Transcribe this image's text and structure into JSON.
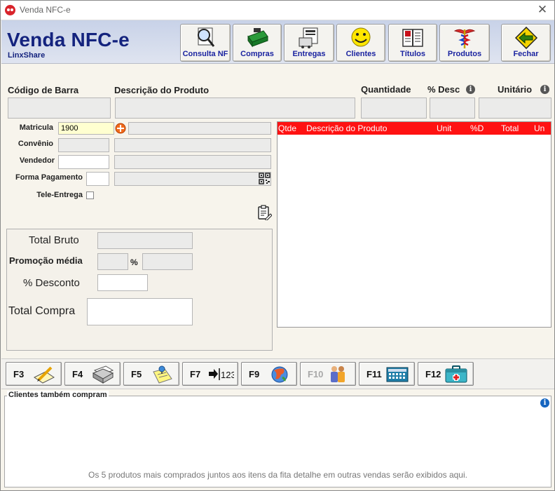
{
  "window": {
    "title": "Venda NFC-e",
    "close_glyph": "✕"
  },
  "header": {
    "brand": "Venda NFC-e",
    "brand_sub": "LinxShare",
    "buttons": [
      {
        "label": "Consulta NF",
        "icon": "magnifier-icon"
      },
      {
        "label": "Compras",
        "icon": "cash-register-icon"
      },
      {
        "label": "Entregas",
        "icon": "delivery-icon"
      },
      {
        "label": "Clientes",
        "icon": "smiley-icon"
      },
      {
        "label": "Títulos",
        "icon": "book-icon"
      },
      {
        "label": "Produtos",
        "icon": "caduceus-icon"
      },
      {
        "label": "Fechar",
        "icon": "exit-arrow-icon"
      }
    ]
  },
  "product_fields": {
    "barcode_label": "Código de Barra",
    "description_label": "Descrição do Produto",
    "quantity_label": "Quantidade",
    "discount_label": "% Desc",
    "unit_label": "Unitário"
  },
  "customer": {
    "matricula_label": "Matricula",
    "matricula_value": "1900",
    "convenio_label": "Convênio",
    "vendedor_label": "Vendedor",
    "forma_pagamento_label": "Forma Pagamento",
    "tele_entrega_label": "Tele-Entrega"
  },
  "grid": {
    "columns": [
      "Qtde",
      "Descrição do Produto",
      "Unit",
      "%D",
      "Total",
      "Un"
    ],
    "rows": []
  },
  "totals": {
    "total_bruto_label": "Total Bruto",
    "promocao_label": "Promoção média",
    "percent_sign": "%",
    "desconto_label": "% Desconto",
    "total_compra_label": "Total Compra"
  },
  "function_keys": [
    {
      "key": "F3",
      "icon": "pencil-notepad-icon",
      "enabled": true
    },
    {
      "key": "F4",
      "icon": "printer-icon",
      "enabled": true
    },
    {
      "key": "F5",
      "icon": "sticky-note-icon",
      "enabled": true
    },
    {
      "key": "F7",
      "icon": "number-entry-icon",
      "enabled": true,
      "icon_text": "123"
    },
    {
      "key": "F9",
      "icon": "globe-icon",
      "enabled": true
    },
    {
      "key": "F10",
      "icon": "people-icon",
      "enabled": false
    },
    {
      "key": "F11",
      "icon": "calculator-icon",
      "enabled": true
    },
    {
      "key": "F12",
      "icon": "medical-kit-icon",
      "enabled": true
    }
  ],
  "recommendations": {
    "title": "Clientes também compram",
    "hint": "Os 5 produtos mais comprados juntos aos itens da fita detalhe em outras vendas serão exibidos aqui."
  },
  "colors": {
    "brand": "#14237e",
    "grid_header": "#ff1212",
    "button_label": "#1a23a0"
  }
}
